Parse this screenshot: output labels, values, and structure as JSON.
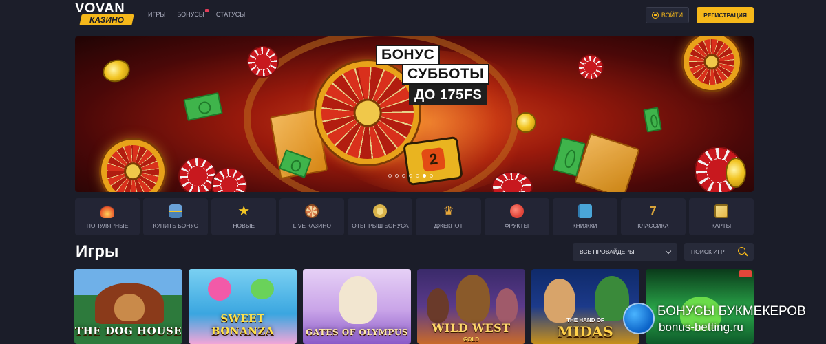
{
  "header": {
    "logo_top": "VOVAN",
    "logo_badge": "КАЗИНО",
    "nav": [
      "ИГРЫ",
      "БОНУСЫ",
      "СТАТУСЫ"
    ],
    "login_label": "ВОЙТИ",
    "register_label": "РЕГИСТРАЦИЯ"
  },
  "banner": {
    "line1": "БОНУС",
    "line2": "СУББОТЫ",
    "line3": "ДО 175FS",
    "slides_total": 7,
    "active_slide": 6
  },
  "categories": [
    {
      "label": "ПОПУЛЯРНЫЕ",
      "icon": "flame-icon",
      "color": "#e8542a"
    },
    {
      "label": "КУПИТЬ БОНУС",
      "icon": "gift-box-icon",
      "color": "#6aa2d8"
    },
    {
      "label": "НОВЫЕ",
      "icon": "star-icon",
      "color": "#f2c524"
    },
    {
      "label": "LIVE КАЗИНО",
      "icon": "roulette-icon",
      "color": "#d77a4a"
    },
    {
      "label": "ОТЫГРЫШ БОНУСА",
      "icon": "badge-icon",
      "color": "#d9b34a"
    },
    {
      "label": "ДЖЕКПОТ",
      "icon": "crown-icon",
      "color": "#e8a83a"
    },
    {
      "label": "ФРУКТЫ",
      "icon": "cherry-icon",
      "color": "#e2463a"
    },
    {
      "label": "КНИЖКИ",
      "icon": "book-icon",
      "color": "#4aa6d8"
    },
    {
      "label": "КЛАССИКА",
      "icon": "seven-icon",
      "color": "#d8a43a"
    },
    {
      "label": "КАРТЫ",
      "icon": "cards-icon",
      "color": "#e6b84a"
    }
  ],
  "games": {
    "title": "Игры",
    "provider_select": "ВСЕ ПРОВАЙДЕРЫ",
    "search_label": "ПОИСК ИГР",
    "tiles": [
      {
        "title": "THE DOG HOUSE",
        "sub": "",
        "bg": "#2d7a3c"
      },
      {
        "title": "SWEET BONANZA",
        "sub": "",
        "bg": "#3aa6e0"
      },
      {
        "title": "GATES OF OLYMPUS",
        "sub": "",
        "bg": "#c9a4e8"
      },
      {
        "title": "WILD WEST",
        "sub": "GOLD",
        "bg": "#5a3a8a"
      },
      {
        "title": "MIDAS",
        "sub": "THE HAND OF",
        "bg": "#1c3a8a"
      },
      {
        "title": "",
        "sub": "",
        "bg": "#2aa84a"
      }
    ]
  },
  "watermark": {
    "title": "БОНУСЫ БУКМЕКЕРОВ",
    "url": "bonus-betting.ru"
  }
}
